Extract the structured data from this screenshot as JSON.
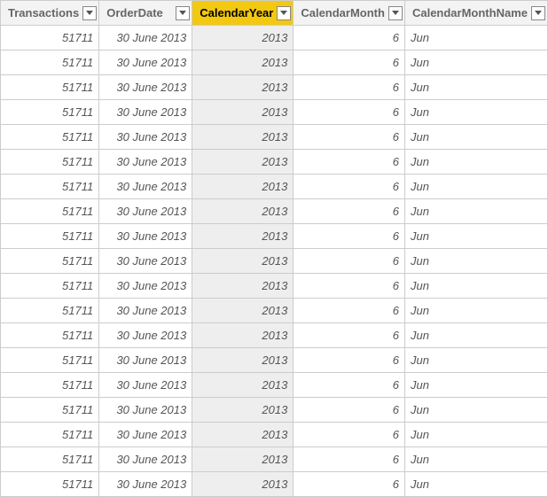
{
  "columns": [
    {
      "key": "transactions",
      "label": "Transactions",
      "align": "num",
      "selected": false
    },
    {
      "key": "orderDate",
      "label": "OrderDate",
      "align": "num",
      "selected": false
    },
    {
      "key": "calendarYear",
      "label": "CalendarYear",
      "align": "num",
      "selected": true
    },
    {
      "key": "calendarMonth",
      "label": "CalendarMonth",
      "align": "num",
      "selected": false
    },
    {
      "key": "calendarMonthName",
      "label": "CalendarMonthName",
      "align": "txt",
      "selected": false
    }
  ],
  "rows": [
    {
      "transactions": "51711",
      "orderDate": "30 June 2013",
      "calendarYear": "2013",
      "calendarMonth": "6",
      "calendarMonthName": "Jun"
    },
    {
      "transactions": "51711",
      "orderDate": "30 June 2013",
      "calendarYear": "2013",
      "calendarMonth": "6",
      "calendarMonthName": "Jun"
    },
    {
      "transactions": "51711",
      "orderDate": "30 June 2013",
      "calendarYear": "2013",
      "calendarMonth": "6",
      "calendarMonthName": "Jun"
    },
    {
      "transactions": "51711",
      "orderDate": "30 June 2013",
      "calendarYear": "2013",
      "calendarMonth": "6",
      "calendarMonthName": "Jun"
    },
    {
      "transactions": "51711",
      "orderDate": "30 June 2013",
      "calendarYear": "2013",
      "calendarMonth": "6",
      "calendarMonthName": "Jun"
    },
    {
      "transactions": "51711",
      "orderDate": "30 June 2013",
      "calendarYear": "2013",
      "calendarMonth": "6",
      "calendarMonthName": "Jun"
    },
    {
      "transactions": "51711",
      "orderDate": "30 June 2013",
      "calendarYear": "2013",
      "calendarMonth": "6",
      "calendarMonthName": "Jun"
    },
    {
      "transactions": "51711",
      "orderDate": "30 June 2013",
      "calendarYear": "2013",
      "calendarMonth": "6",
      "calendarMonthName": "Jun"
    },
    {
      "transactions": "51711",
      "orderDate": "30 June 2013",
      "calendarYear": "2013",
      "calendarMonth": "6",
      "calendarMonthName": "Jun"
    },
    {
      "transactions": "51711",
      "orderDate": "30 June 2013",
      "calendarYear": "2013",
      "calendarMonth": "6",
      "calendarMonthName": "Jun"
    },
    {
      "transactions": "51711",
      "orderDate": "30 June 2013",
      "calendarYear": "2013",
      "calendarMonth": "6",
      "calendarMonthName": "Jun"
    },
    {
      "transactions": "51711",
      "orderDate": "30 June 2013",
      "calendarYear": "2013",
      "calendarMonth": "6",
      "calendarMonthName": "Jun"
    },
    {
      "transactions": "51711",
      "orderDate": "30 June 2013",
      "calendarYear": "2013",
      "calendarMonth": "6",
      "calendarMonthName": "Jun"
    },
    {
      "transactions": "51711",
      "orderDate": "30 June 2013",
      "calendarYear": "2013",
      "calendarMonth": "6",
      "calendarMonthName": "Jun"
    },
    {
      "transactions": "51711",
      "orderDate": "30 June 2013",
      "calendarYear": "2013",
      "calendarMonth": "6",
      "calendarMonthName": "Jun"
    },
    {
      "transactions": "51711",
      "orderDate": "30 June 2013",
      "calendarYear": "2013",
      "calendarMonth": "6",
      "calendarMonthName": "Jun"
    },
    {
      "transactions": "51711",
      "orderDate": "30 June 2013",
      "calendarYear": "2013",
      "calendarMonth": "6",
      "calendarMonthName": "Jun"
    },
    {
      "transactions": "51711",
      "orderDate": "30 June 2013",
      "calendarYear": "2013",
      "calendarMonth": "6",
      "calendarMonthName": "Jun"
    },
    {
      "transactions": "51711",
      "orderDate": "30 June 2013",
      "calendarYear": "2013",
      "calendarMonth": "6",
      "calendarMonthName": "Jun"
    }
  ]
}
